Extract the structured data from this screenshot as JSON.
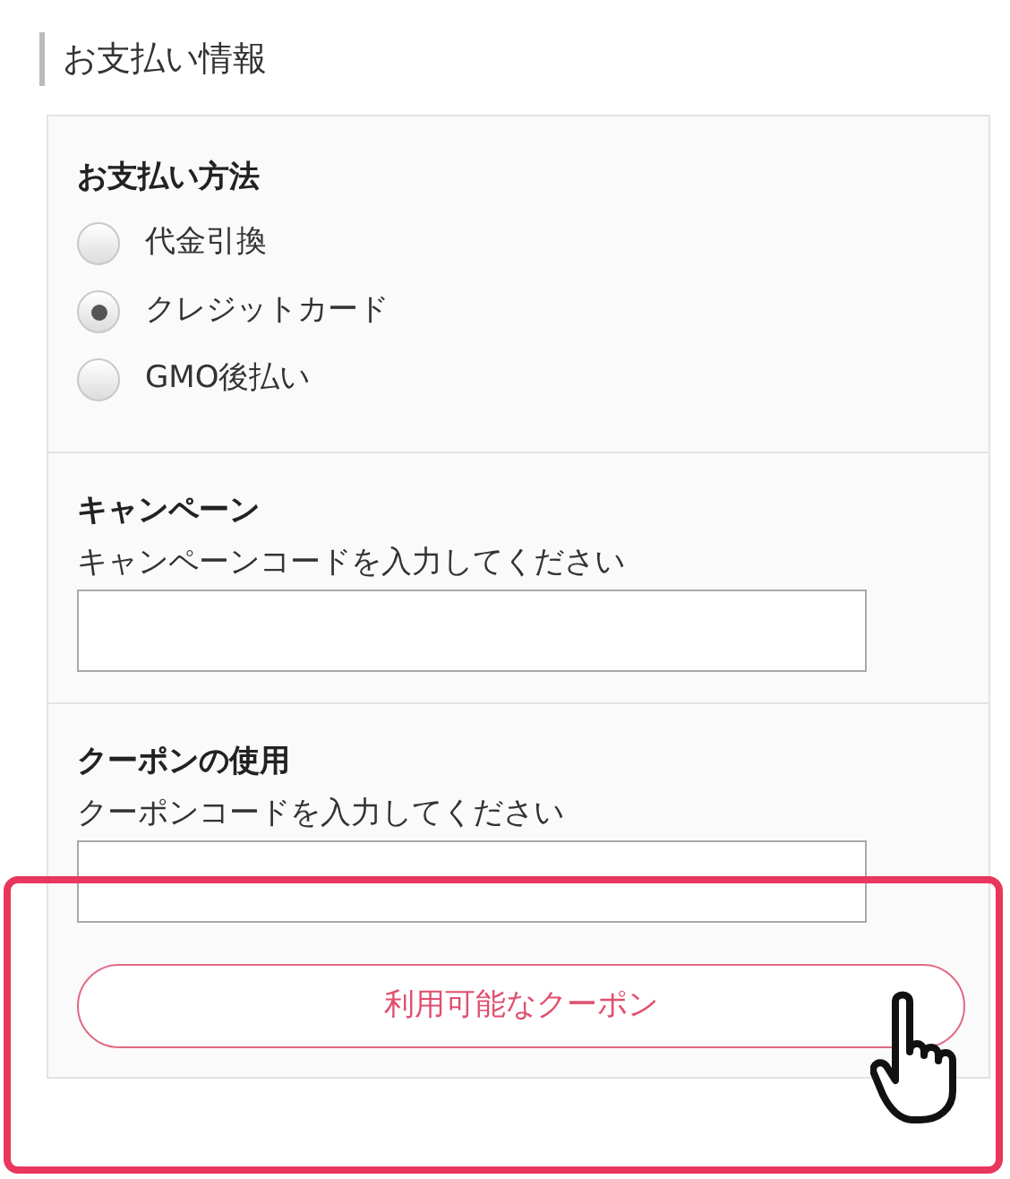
{
  "heading": "お支払い情報",
  "payment": {
    "title": "お支払い方法",
    "options": [
      {
        "label": "代金引換",
        "selected": false
      },
      {
        "label": "クレジットカード",
        "selected": true
      },
      {
        "label": "GMO後払い",
        "selected": false
      }
    ]
  },
  "campaign": {
    "title": "キャンペーン",
    "hint": "キャンペーンコードを入力してください"
  },
  "coupon": {
    "title": "クーポンの使用",
    "hint": "クーポンコードを入力してください",
    "button": "利用可能なクーポン"
  }
}
